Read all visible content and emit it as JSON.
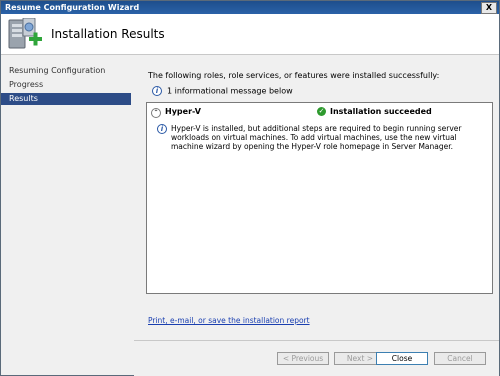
{
  "window": {
    "title": "Resume Configuration Wizard",
    "close_label": "X"
  },
  "header": {
    "title": "Installation Results",
    "icon": "server-manager-add-icon"
  },
  "sidebar": {
    "items": [
      {
        "label": "Resuming Configuration",
        "active": false
      },
      {
        "label": "Progress",
        "active": false
      },
      {
        "label": "Results",
        "active": true
      }
    ]
  },
  "main": {
    "intro": "The following roles, role services, or features were installed successfully:",
    "info_message": "1 informational message below",
    "results": {
      "role": "Hyper-V",
      "status": "Installation succeeded",
      "detail": "Hyper-V is installed, but additional steps are required to begin running server workloads on virtual machines. To add virtual machines, use the new virtual machine wizard by opening the Hyper-V role homepage in Server Manager."
    },
    "report_link": "Print, e-mail, or save the installation report"
  },
  "footer": {
    "previous": "< Previous",
    "next": "Next >",
    "close": "Close",
    "cancel": "Cancel"
  },
  "colors": {
    "title_bar": "#2a62a8",
    "nav_active": "#2d4c87",
    "success": "#2e9a2e",
    "link": "#1a3fb0"
  }
}
